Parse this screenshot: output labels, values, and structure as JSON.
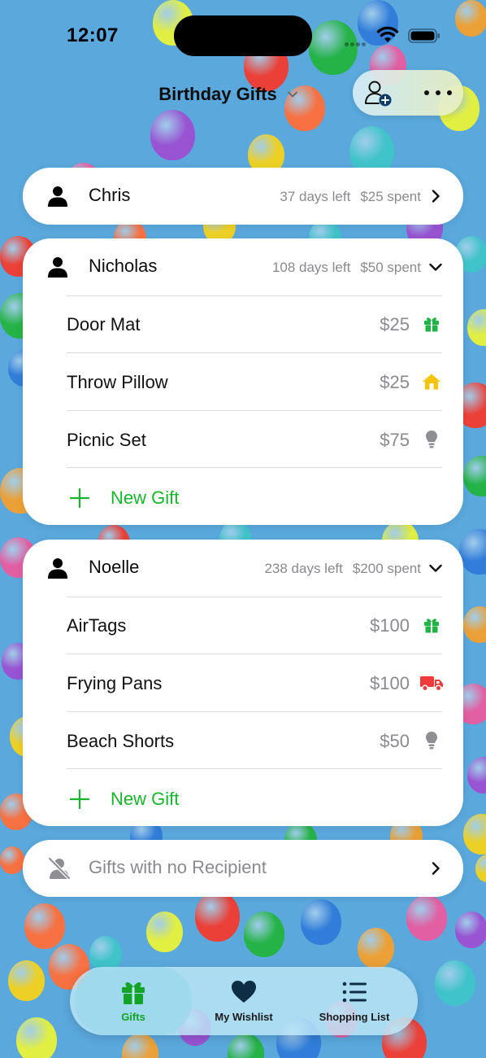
{
  "status_bar": {
    "time": "12:07"
  },
  "header": {
    "title": "Birthday Gifts",
    "title_icon": "chevron-down-icon",
    "add_person_icon": "person-add-icon",
    "more_icon": "ellipsis-icon"
  },
  "recipients": [
    {
      "name": "Chris",
      "days_left": "37 days left",
      "spent": "$25 spent",
      "expanded": false,
      "gifts": []
    },
    {
      "name": "Nicholas",
      "days_left": "108 days left",
      "spent": "$50 spent",
      "expanded": true,
      "gifts": [
        {
          "name": "Door Mat",
          "price": "$25",
          "status_icon": "gift-icon",
          "status_color": "#22b347"
        },
        {
          "name": "Throw Pillow",
          "price": "$25",
          "status_icon": "house-icon",
          "status_color": "#f7c400"
        },
        {
          "name": "Picnic Set",
          "price": "$75",
          "status_icon": "lightbulb-icon",
          "status_color": "#8e8e93"
        }
      ],
      "new_gift_label": "New Gift"
    },
    {
      "name": "Noelle",
      "days_left": "238 days left",
      "spent": "$200 spent",
      "expanded": true,
      "gifts": [
        {
          "name": "AirTags",
          "price": "$100",
          "status_icon": "gift-icon",
          "status_color": "#22b347"
        },
        {
          "name": "Frying Pans",
          "price": "$100",
          "status_icon": "truck-icon",
          "status_color": "#ef3b3b"
        },
        {
          "name": "Beach Shorts",
          "price": "$50",
          "status_icon": "lightbulb-icon",
          "status_color": "#8e8e93"
        }
      ],
      "new_gift_label": "New Gift"
    }
  ],
  "no_recipient": {
    "label": "Gifts with no Recipient",
    "icon": "person-slash-icon"
  },
  "tab_bar": {
    "tabs": [
      {
        "label": "Gifts",
        "icon": "gift-icon",
        "selected": true
      },
      {
        "label": "My Wishlist",
        "icon": "heart-icon",
        "selected": false
      },
      {
        "label": "Shopping List",
        "icon": "list-icon",
        "selected": false
      }
    ]
  },
  "colors": {
    "accent_green": "#16b52b",
    "secondary_text": "#8a8a8e",
    "background": "#5aa8dc"
  }
}
